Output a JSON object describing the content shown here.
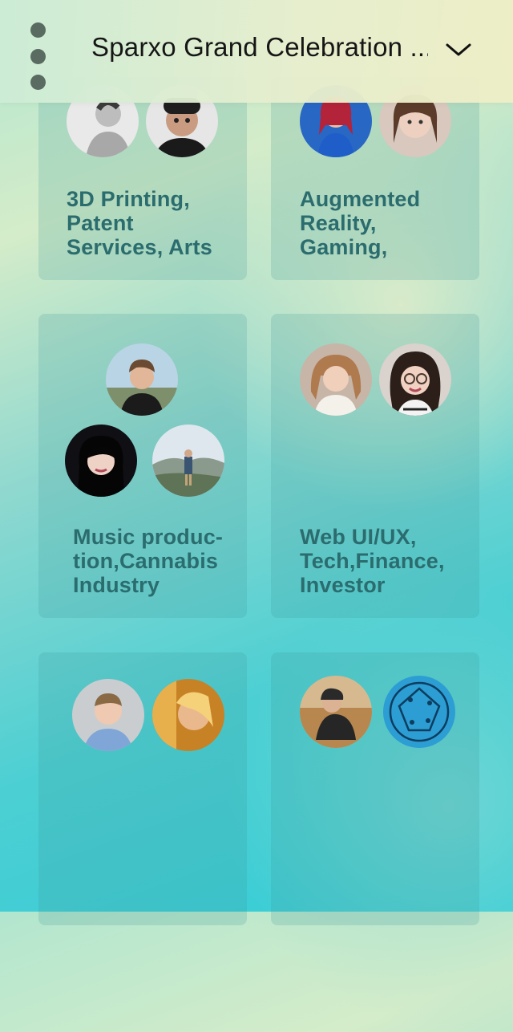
{
  "header": {
    "title": "Sparxo Grand Celebration ...",
    "menu_icon": "vertical-ellipsis-icon",
    "dropdown_icon": "chevron-down-icon"
  },
  "cards": [
    {
      "label": "3D Printing,\nPatent\nServices, Arts"
    },
    {
      "label": "Augmented\nReality,\nGaming,"
    },
    {
      "label": "Music produc-\ntion,Cannabis\nIndustry"
    },
    {
      "label": "Web UI/UX,\nTech,Finance,\nInvestor"
    },
    {
      "label": ""
    },
    {
      "label": ""
    }
  ],
  "colors": {
    "card_text": "#2b6c6e",
    "header_text": "#161616",
    "menu_dots": "#5a6b62"
  }
}
